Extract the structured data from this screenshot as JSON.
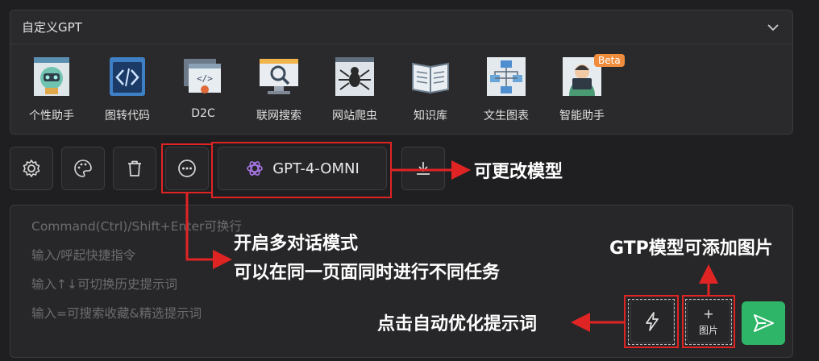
{
  "panel": {
    "title": "自定义GPT"
  },
  "tools": [
    {
      "label": "个性助手",
      "icon": "robot-icon"
    },
    {
      "label": "图转代码",
      "icon": "code-icon"
    },
    {
      "label": "D2C",
      "icon": "design-to-code-icon"
    },
    {
      "label": "联网搜索",
      "icon": "web-search-icon"
    },
    {
      "label": "网站爬虫",
      "icon": "spider-icon"
    },
    {
      "label": "知识库",
      "icon": "book-icon"
    },
    {
      "label": "文生图表",
      "icon": "flowchart-icon"
    },
    {
      "label": "智能助手",
      "icon": "assistant-icon",
      "badge": "Beta"
    }
  ],
  "toolbar": {
    "model_label": "GPT-4-OMNI"
  },
  "input": {
    "placeholder_lines": [
      "Command(Ctrl)/Shift+Enter可换行",
      "输入/呼起快捷指令",
      "输入↑↓可切换历史提示词",
      "输入=可搜索收藏&精选提示词"
    ],
    "image_button_plus": "+",
    "image_button_label": "图片"
  },
  "annotations": {
    "change_model": "可更改模型",
    "multi_dialog_1": "开启多对话模式",
    "multi_dialog_2": "可以在同一页面同时进行不同任务",
    "gtp_image": "GTP模型可添加图片",
    "optimize_prompt": "点击自动优化提示词"
  },
  "colors": {
    "annotation_red": "#e02424",
    "send_green": "#2fb567",
    "beta_orange": "#f08d3c"
  }
}
